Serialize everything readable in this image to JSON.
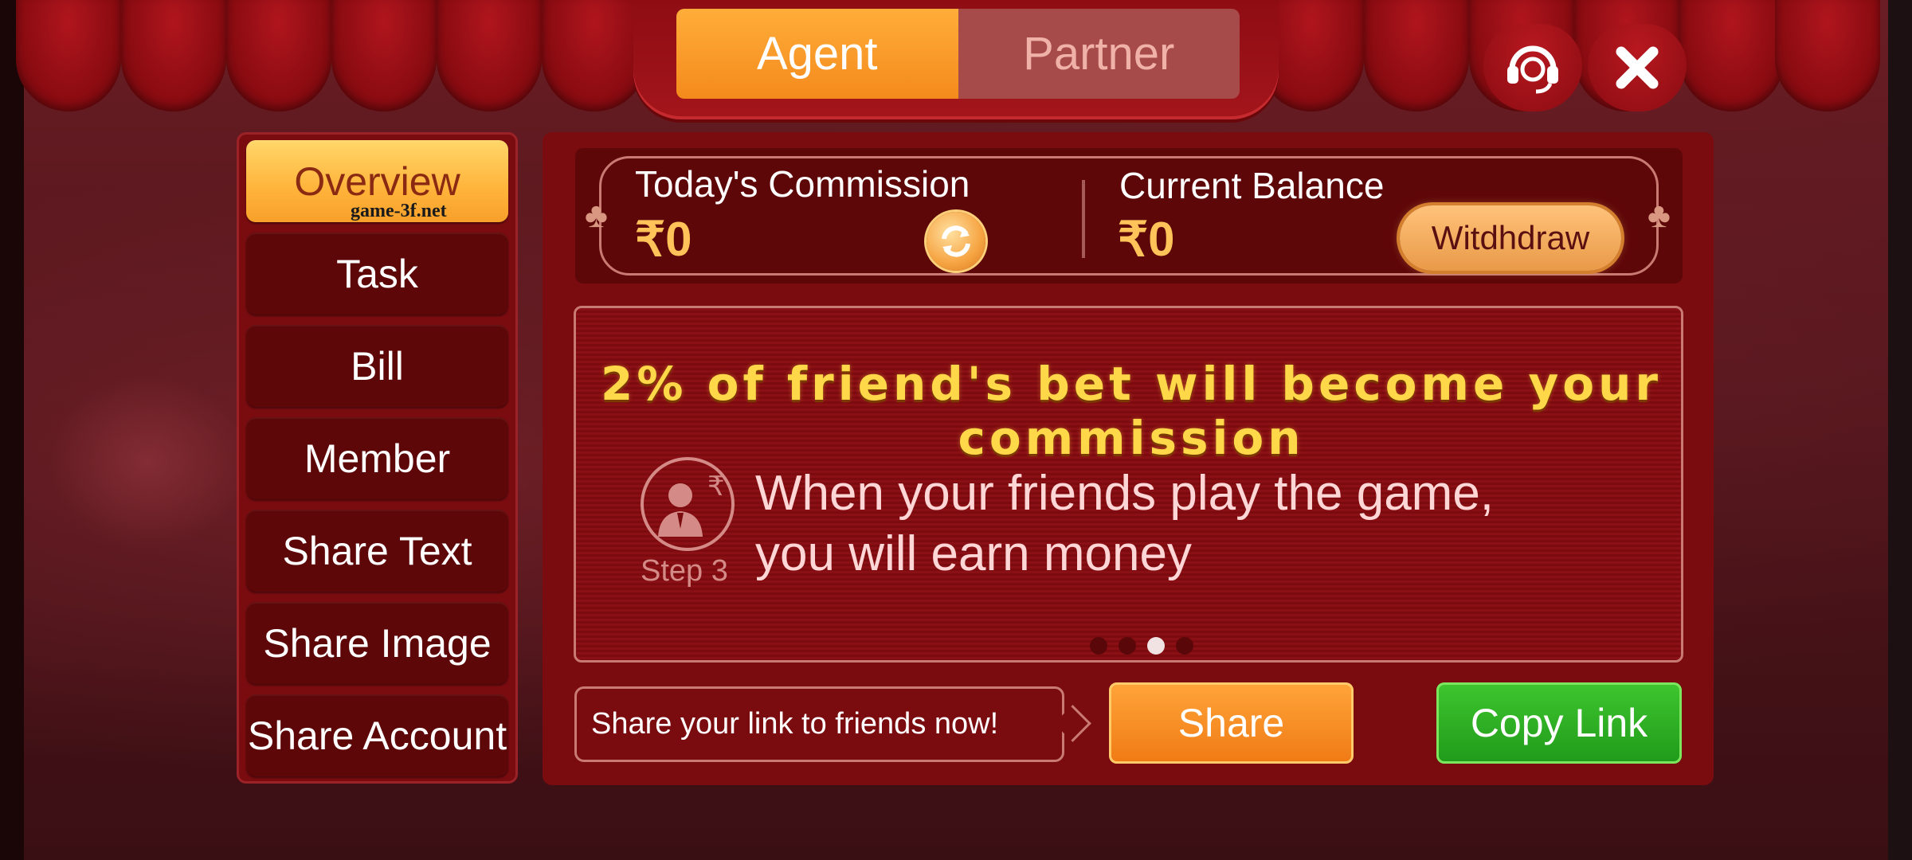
{
  "tabs": {
    "agent": "Agent",
    "partner": "Partner"
  },
  "top_buttons": [
    {
      "icon": "headset-icon"
    },
    {
      "icon": "close-icon"
    }
  ],
  "sidebar": {
    "items": [
      {
        "label": "Overview",
        "active": true
      },
      {
        "label": "Task"
      },
      {
        "label": "Bill"
      },
      {
        "label": "Member"
      },
      {
        "label": "Share Text"
      },
      {
        "label": "Share Image"
      },
      {
        "label": "Share Account"
      }
    ]
  },
  "watermark": "game-3f.net",
  "stats": {
    "todays_commission_label": "Today's Commission",
    "todays_commission_value": "₹0",
    "current_balance_label": "Current Balance",
    "current_balance_value": "₹0",
    "withdraw_label": "Witdhdraw"
  },
  "banner": {
    "headline": "2% of friend's bet will become your commission",
    "step_label": "Step 3",
    "step_text_line1": "When your friends play the game,",
    "step_text_line2": "you will earn money",
    "carousel_count": 4,
    "carousel_active": 3
  },
  "share": {
    "tip": "Share your link to friends now!",
    "share_label": "Share",
    "copy_label": "Copy Link"
  },
  "colors": {
    "accent_orange": "#f48a1c",
    "copy_green": "#1f9a1a",
    "panel_red": "#7a0c10",
    "gold_text": "#ffd84a"
  }
}
